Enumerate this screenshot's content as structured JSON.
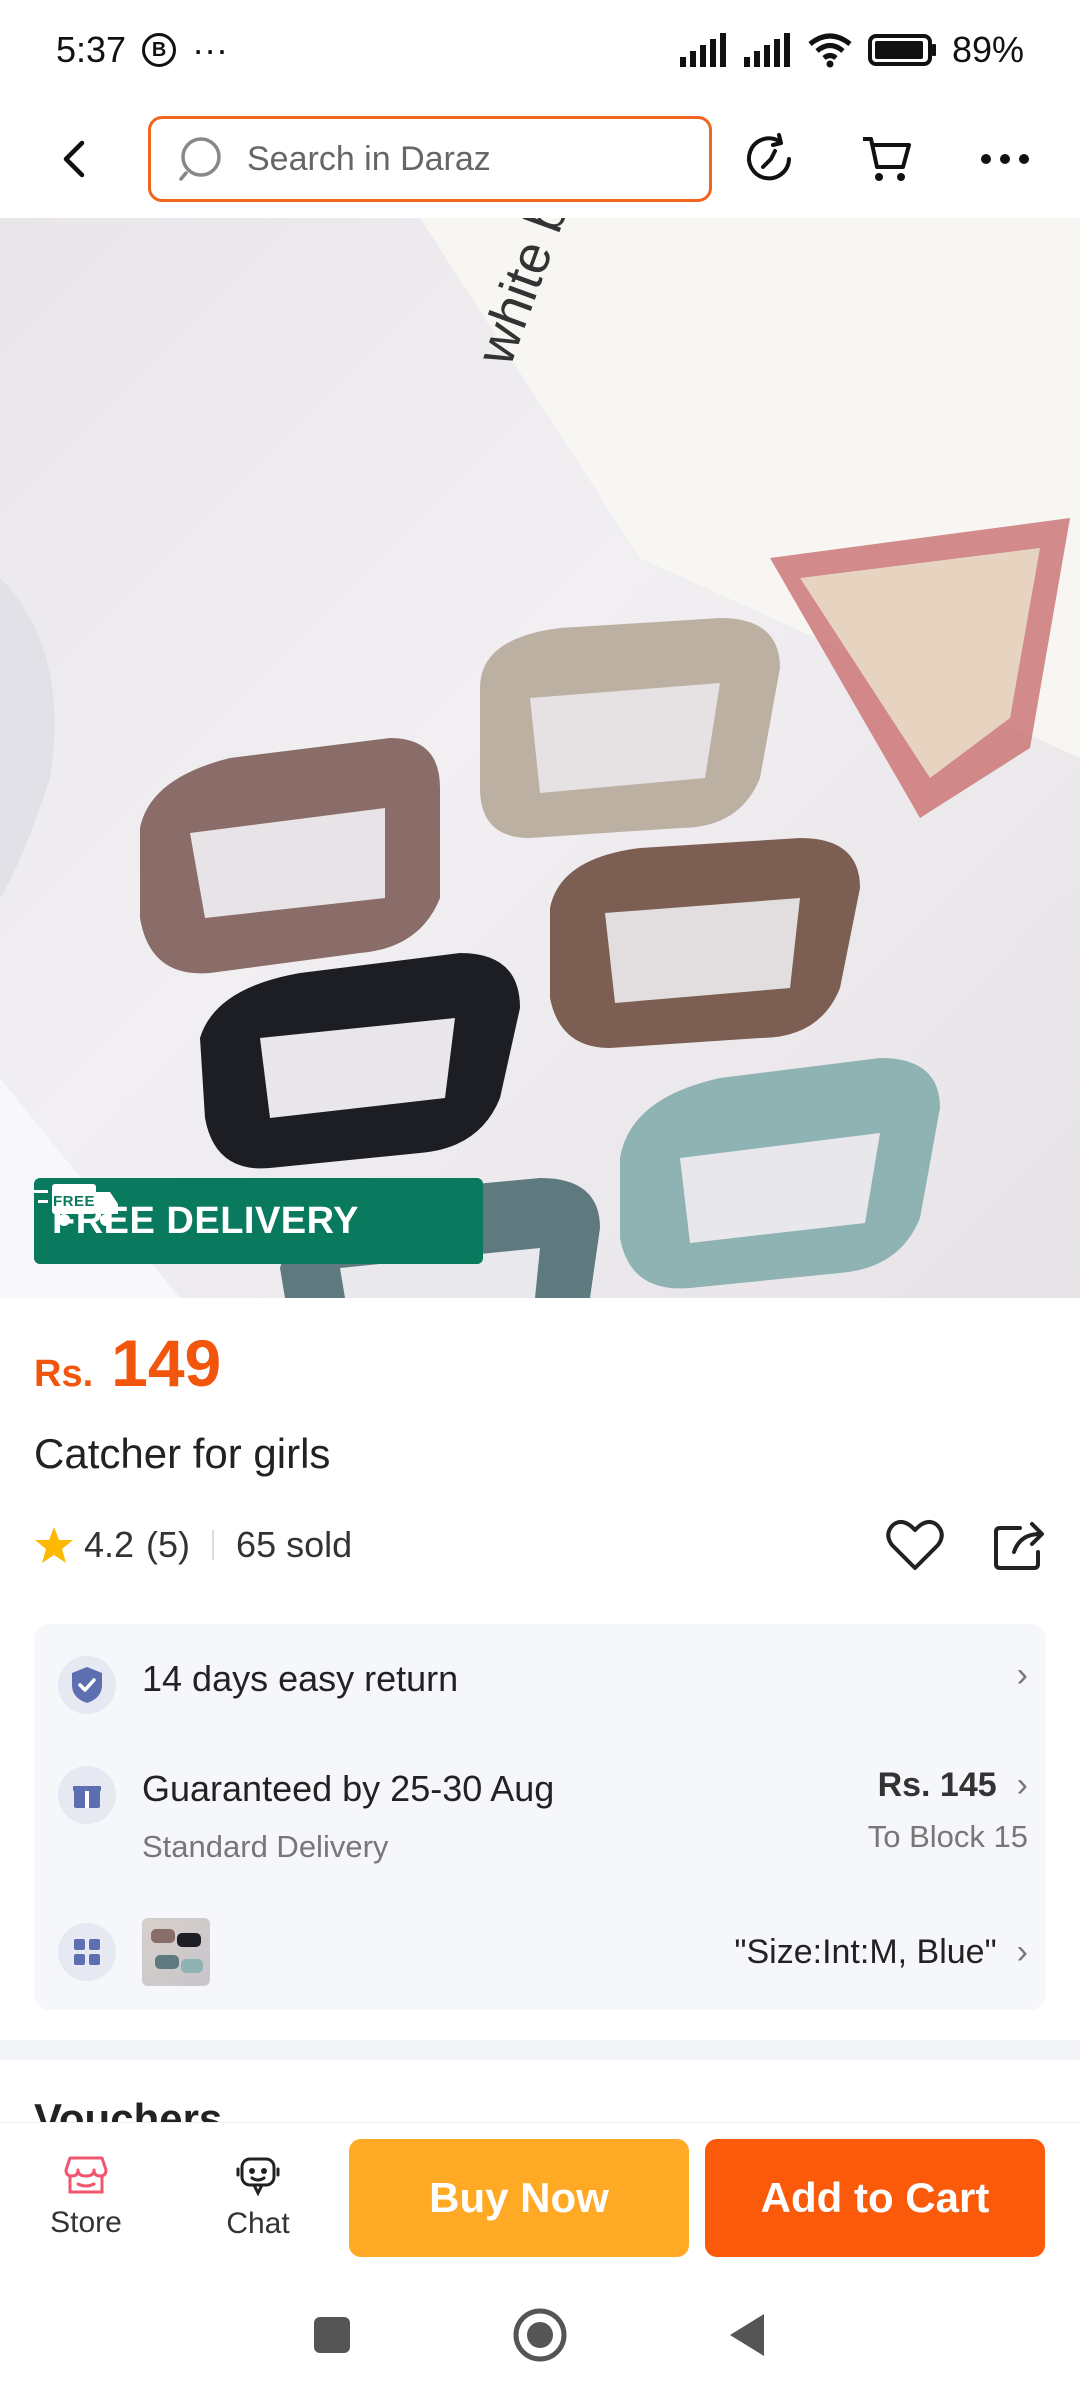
{
  "status_bar": {
    "time": "5:37",
    "b_icon_letter": "B",
    "dots": "···",
    "battery": "89%"
  },
  "header": {
    "search_placeholder": "Search in Daraz"
  },
  "product": {
    "free_delivery_label": "FREE DELIVERY",
    "free_icon_text": "FREE",
    "image_text": "white bla",
    "price_currency": "Rs.",
    "price_value": "149",
    "title": "Catcher for girls",
    "rating": "4.2",
    "rating_count": "(5)",
    "sold": "65 sold"
  },
  "info_card": {
    "return_label": "14 days easy return",
    "delivery_label": "Guaranteed by 25-30 Aug",
    "delivery_sub": "Standard Delivery",
    "delivery_price": "Rs. 145",
    "delivery_location": "To Block 15",
    "variant_label": "\"Size:Int:M, Blue\""
  },
  "section_partial": {
    "vouchers_label": "Vouchers"
  },
  "bottom_bar": {
    "store_label": "Store",
    "chat_label": "Chat",
    "buy_now_label": "Buy Now",
    "add_to_cart_label": "Add to Cart"
  },
  "colors": {
    "accent": "#f2560d",
    "buy_now": "#ffa925",
    "add_to_cart": "#fa5a0a",
    "free_delivery": "#0a7a5e"
  }
}
